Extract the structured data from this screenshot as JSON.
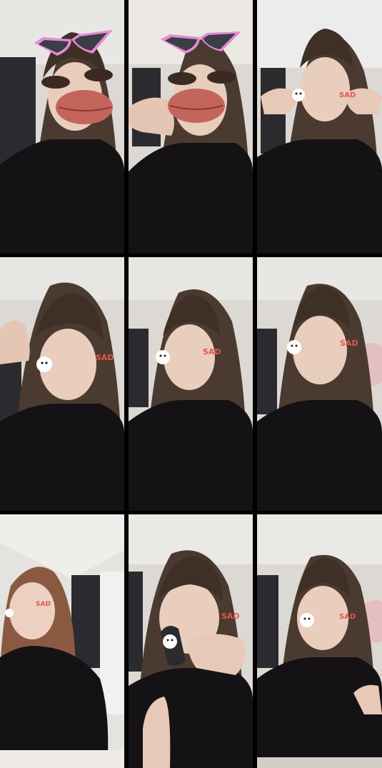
{
  "collage": {
    "panels": [
      {
        "id": "p1",
        "sticker_text": "",
        "filter": "sunglasses-lips"
      },
      {
        "id": "p2",
        "sticker_text": "",
        "filter": "sunglasses-lips"
      },
      {
        "id": "p3",
        "sticker_text": "SAD",
        "filter": "bear-sticker"
      },
      {
        "id": "p4",
        "sticker_text": "SAD",
        "filter": "bear-sticker"
      },
      {
        "id": "p5",
        "sticker_text": "SAD",
        "filter": "bear-sticker"
      },
      {
        "id": "p6",
        "sticker_text": "SAD",
        "filter": "bear-sticker"
      },
      {
        "id": "p7",
        "sticker_text": "SAD",
        "filter": "bear-sticker"
      },
      {
        "id": "p8",
        "sticker_text": "SAD",
        "filter": "bear-sticker"
      },
      {
        "id": "p9",
        "sticker_text": "SAD",
        "filter": "bear-sticker"
      }
    ]
  },
  "colors": {
    "wall": "#d9d6d2",
    "hair": "#4a3a30",
    "skin": "#e9cdbd",
    "jacket": "#141214",
    "lips": "#c4655c",
    "glasses": "#e58ad6",
    "sticker_text": [
      "#e0584f",
      "#f2b83a",
      "#4cb6e8"
    ]
  }
}
